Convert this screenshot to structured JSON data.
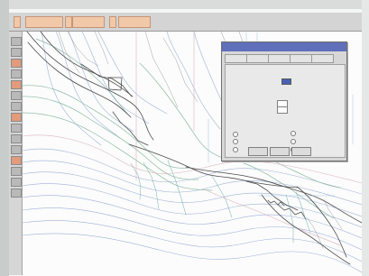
{
  "colors": {
    "screen": "#f4f6f5",
    "toolbar": "#d4d4d4",
    "accent": "#e39b7b",
    "title_bar": "#5f6fba",
    "line_blue": "#8ea5d4",
    "line_green": "#7fb39b",
    "line_gray": "#4c4c4c",
    "line_pink": "#d9a6b6"
  },
  "icons": {
    "toolbar_orange": "orange-toolbar-icon",
    "tool_palette": "tool-palette-icon",
    "radio": "radio-button-icon"
  },
  "dialog": {
    "title": "",
    "tabs": [
      "",
      "",
      "",
      "",
      ""
    ],
    "fields": [
      "",
      "",
      ""
    ],
    "buttons": [
      "",
      "",
      ""
    ]
  },
  "drawing": {
    "label": ""
  }
}
